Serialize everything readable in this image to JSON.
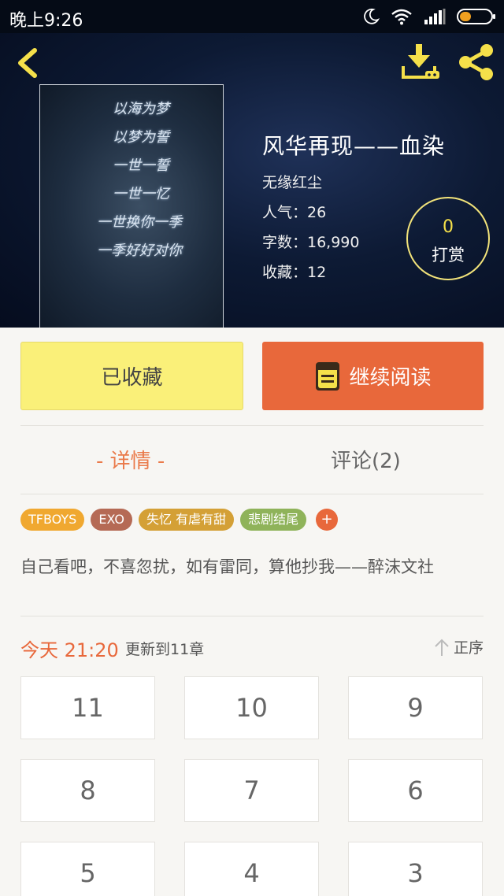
{
  "status_bar": {
    "time": "晚上9:26",
    "icons": [
      "moon-icon",
      "wifi-icon",
      "signal-icon",
      "battery-icon"
    ]
  },
  "header": {
    "icons": [
      "back-arrow-icon",
      "download-icon",
      "share-icon"
    ],
    "icon_color": "#f5e04a"
  },
  "cover": {
    "lines": [
      "以海为梦",
      "以梦为誓",
      "一世一誓",
      "一世一忆",
      "一世换你一季",
      "一季好好对你"
    ]
  },
  "book": {
    "title": "风华再现——血染",
    "author": "无缘红尘",
    "popularity": "人气：26",
    "word_count": "字数：16,990",
    "favorites": "收藏：12"
  },
  "reward": {
    "count": "0",
    "label": "打赏"
  },
  "actions": {
    "collected_label": "已收藏",
    "continue_label": "继续阅读",
    "continue_icon": "book-icon"
  },
  "tabs": {
    "detail": "- 详情 -",
    "comments": "评论(2)"
  },
  "tags": [
    {
      "label": "TFBOYS",
      "color": "#f0a830"
    },
    {
      "label": "EXO",
      "color": "#b56a55"
    },
    {
      "label": "失忆  有虐有甜",
      "color": "#d4a036"
    },
    {
      "label": "悲剧结尾",
      "color": "#8fb35a"
    }
  ],
  "tag_add": "+",
  "description": "自己看吧，不喜忽扰，如有雷同，算他抄我——醉沫文社",
  "update": {
    "time": "今天 21:20",
    "text": "更新到11章",
    "sort_label": "正序"
  },
  "chapters": [
    "11",
    "10",
    "9",
    "8",
    "7",
    "6",
    "5",
    "4",
    "3"
  ],
  "colors": {
    "accent": "#e8683b",
    "collected_button": "#faf079"
  }
}
